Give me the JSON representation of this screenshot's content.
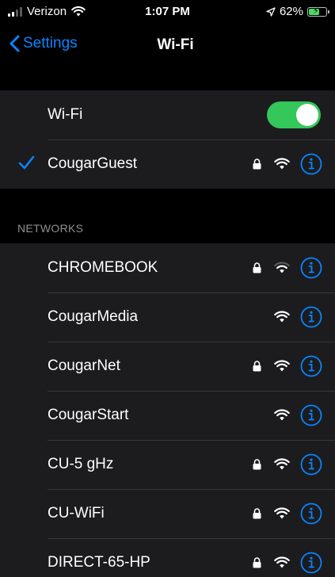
{
  "status_bar": {
    "carrier": "Verizon",
    "time": "1:07 PM",
    "battery_percent": "62%",
    "battery_level": 0.62,
    "icons": [
      "signal-icon",
      "wifi-status-icon",
      "location-arrow-icon",
      "battery-charging-icon"
    ]
  },
  "nav": {
    "back_label": "Settings",
    "title": "Wi-Fi"
  },
  "wifi_toggle": {
    "label": "Wi-Fi",
    "on": true
  },
  "connected": {
    "name": "CougarGuest",
    "secured": true
  },
  "networks_header": "NETWORKS",
  "networks": [
    {
      "name": "CHROMEBOOK",
      "secured": true,
      "signal": "weak"
    },
    {
      "name": "CougarMedia",
      "secured": false,
      "signal": "full"
    },
    {
      "name": "CougarNet",
      "secured": true,
      "signal": "full"
    },
    {
      "name": "CougarStart",
      "secured": false,
      "signal": "full"
    },
    {
      "name": "CU-5 gHz",
      "secured": true,
      "signal": "full"
    },
    {
      "name": "CU-WiFi",
      "secured": true,
      "signal": "full"
    },
    {
      "name": "DIRECT-65-HP",
      "secured": true,
      "signal": "full"
    }
  ],
  "colors": {
    "accent": "#0a84ff",
    "toggle_on": "#34c759",
    "row_bg": "#1c1c1e",
    "page_bg": "#000000",
    "separator": "#38383a",
    "secondary_text": "#8e8e93"
  }
}
